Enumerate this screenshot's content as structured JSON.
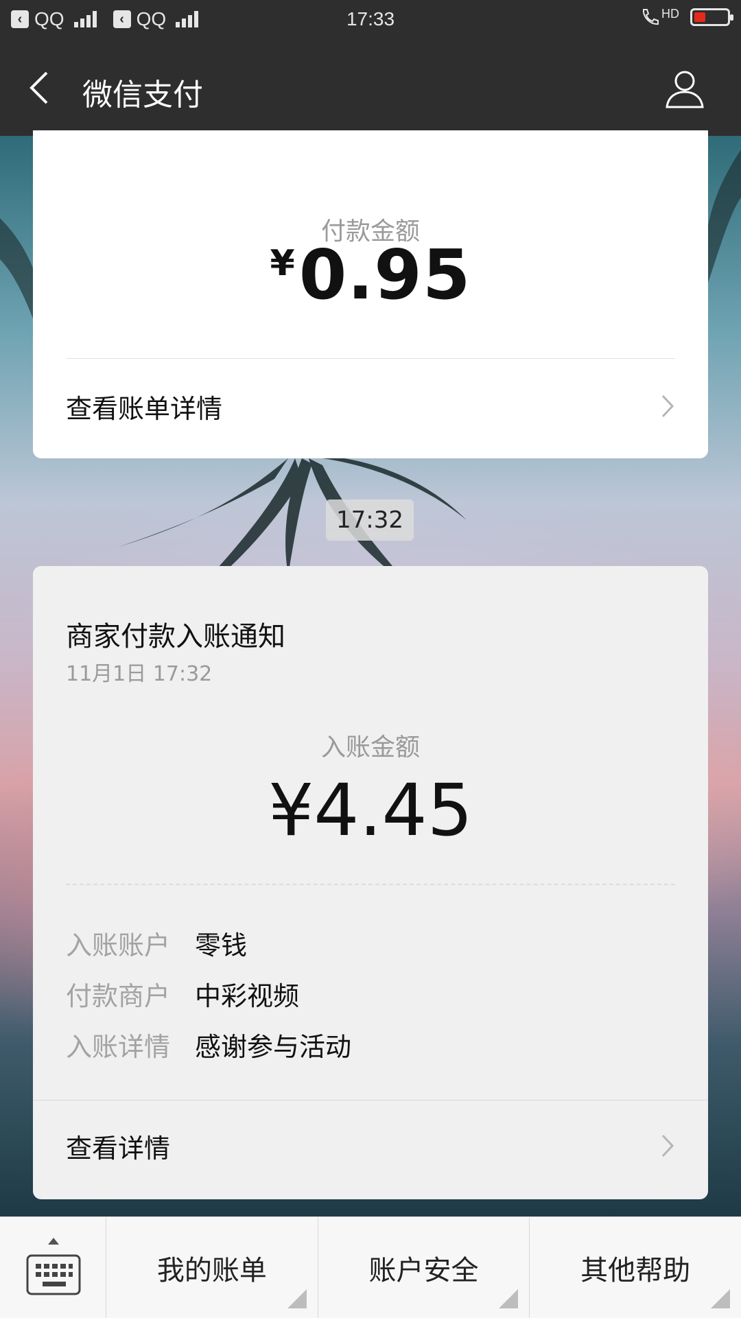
{
  "status_bar": {
    "qq_label_1": "QQ",
    "qq_label_2": "QQ",
    "time": "17:33",
    "hd_label": "HD",
    "battery_level": 0.35
  },
  "header": {
    "title": "微信支付"
  },
  "payment_card": {
    "label": "付款金额",
    "currency": "¥",
    "amount": "0.95",
    "link_label": "查看账单详情"
  },
  "timestamp": "17:32",
  "notice_card": {
    "title": "商家付款入账通知",
    "date": "11月1日  17:32",
    "label": "入账金额",
    "amount": "¥4.45",
    "fields": [
      {
        "key": "入账账户",
        "value": "零钱"
      },
      {
        "key": "付款商户",
        "value": "中彩视频"
      },
      {
        "key": "入账详情",
        "value": "感谢参与活动"
      }
    ],
    "link_label": "查看详情"
  },
  "bottom_menu": {
    "items": [
      {
        "label": "我的账单"
      },
      {
        "label": "账户安全"
      },
      {
        "label": "其他帮助"
      }
    ]
  },
  "colors": {
    "header_bg": "#2e2e2e",
    "card_bg": "#ffffff",
    "notice_bg": "#f0f0f0",
    "battery_fill": "#e32a1d"
  }
}
